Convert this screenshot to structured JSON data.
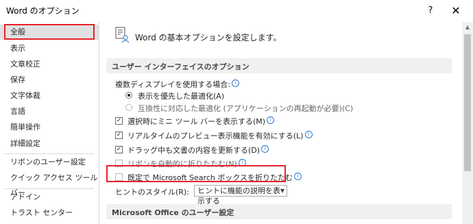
{
  "window": {
    "title": "Word のオプション",
    "help_label": "?",
    "close_label": "✕"
  },
  "sidebar": {
    "items": [
      {
        "label": "全般"
      },
      {
        "label": "表示"
      },
      {
        "label": "文章校正"
      },
      {
        "label": "保存"
      },
      {
        "label": "文字体裁"
      },
      {
        "label": "言語"
      },
      {
        "label": "簡単操作"
      },
      {
        "label": "詳細設定"
      },
      {
        "label": "リボンのユーザー設定"
      },
      {
        "label": "クイック アクセス ツール バー"
      },
      {
        "label": "アドイン"
      },
      {
        "label": "トラスト センター"
      }
    ],
    "selected_index": 0
  },
  "content": {
    "header": "Word の基本オプションを設定します。",
    "section1": "ユーザー インターフェイスのオプション",
    "multi_display_label": "複数ディスプレイを使用する場合:",
    "radio_optimize_appearance": "表示を優先した最適化(A)",
    "radio_optimize_compat": "互換性に対応した最適化 (アプリケーションの再起動が必要)(C)",
    "check_mini_toolbar": "選択時にミニ ツール バーを表示する(M)",
    "check_live_preview": "リアルタイムのプレビュー表示機能を有効にする(L)",
    "check_update_drag": "ドラッグ中も文書の内容を更新する(D)",
    "check_collapse_ribbon": "リボンを自動的に折りたたむ(N)",
    "check_collapse_search": "既定で Microsoft Search ボックスを折りたたむ",
    "tooltip_style_label": "ヒントのスタイル(R):",
    "tooltip_style_value": "ヒントに機能の説明を表示する",
    "section2": "Microsoft Office のユーザー設定",
    "info_glyph": "i"
  },
  "states": {
    "radio_optimize_appearance": true,
    "radio_optimize_compat": false,
    "check_mini_toolbar": true,
    "check_live_preview": true,
    "check_update_drag": true,
    "check_collapse_ribbon": false,
    "check_collapse_search": false
  },
  "colors": {
    "highlight_border": "#e8202a",
    "selected_bg": "#e1e1e1",
    "info_blue": "#2b79d1"
  },
  "icons": [
    "options-general-icon",
    "info-icon",
    "dropdown-arrow-icon"
  ]
}
